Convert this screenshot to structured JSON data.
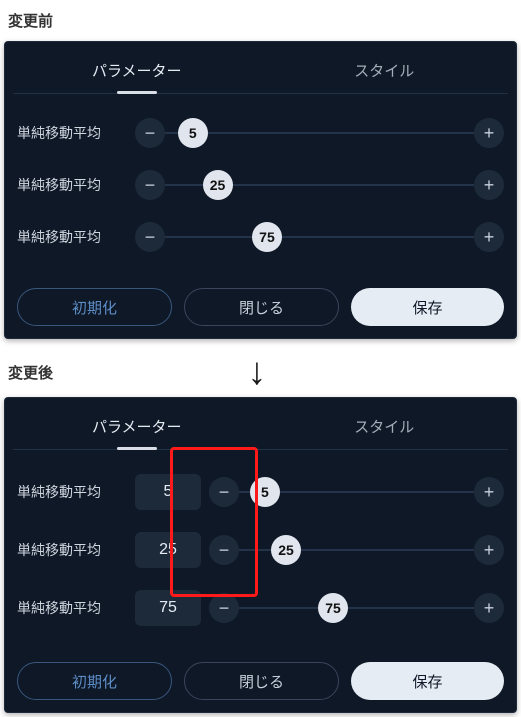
{
  "before": {
    "heading": "変更前",
    "tabs": {
      "params": "パラメーター",
      "style": "スタイル"
    },
    "rows": [
      {
        "label": "単純移動平均",
        "value": "5",
        "pos": 9
      },
      {
        "label": "単純移動平均",
        "value": "25",
        "pos": 17
      },
      {
        "label": "単純移動平均",
        "value": "75",
        "pos": 33
      }
    ],
    "footer": {
      "init": "初期化",
      "close": "閉じる",
      "save": "保存"
    }
  },
  "after": {
    "heading": "変更後",
    "tabs": {
      "params": "パラメーター",
      "style": "スタイル"
    },
    "rows": [
      {
        "label": "単純移動平均",
        "input": "5",
        "value": "5",
        "pos": 11
      },
      {
        "label": "単純移動平均",
        "input": "25",
        "value": "25",
        "pos": 20
      },
      {
        "label": "単純移動平均",
        "input": "75",
        "value": "75",
        "pos": 40
      }
    ],
    "footer": {
      "init": "初期化",
      "close": "閉じる",
      "save": "保存"
    }
  },
  "glyphs": {
    "minus": "−",
    "plus": "+"
  }
}
